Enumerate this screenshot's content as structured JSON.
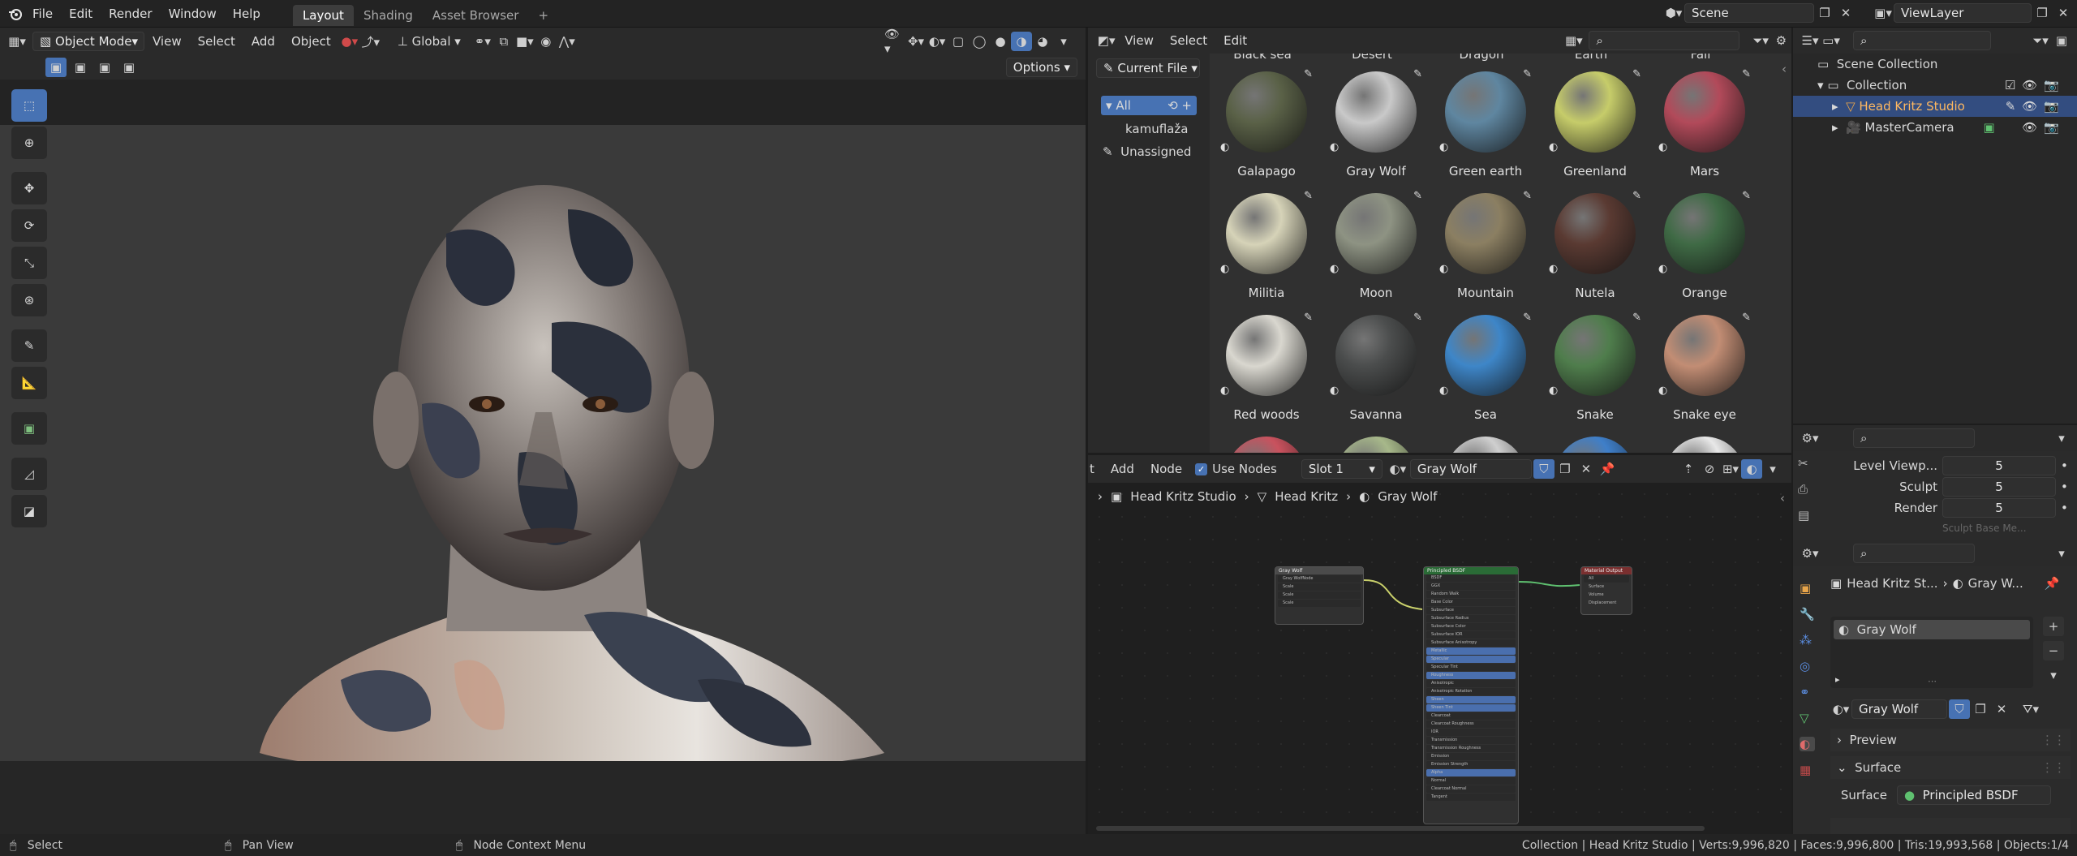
{
  "topbar": {
    "menus": [
      "File",
      "Edit",
      "Render",
      "Window",
      "Help"
    ],
    "workspaces": [
      {
        "label": "Layout",
        "active": true
      },
      {
        "label": "Shading",
        "active": false
      },
      {
        "label": "Asset Browser",
        "active": false
      }
    ],
    "add_tab": "+",
    "scene": "Scene",
    "view_layer": "ViewLayer"
  },
  "viewport": {
    "mode": "Object Mode",
    "menus": [
      "View",
      "Select",
      "Add",
      "Object"
    ],
    "orientation": "Global",
    "options_label": "Options"
  },
  "asset_browser": {
    "menus": [
      "View",
      "Select",
      "Edit"
    ],
    "library": "Current File",
    "catalogs": [
      "All",
      "kamuflaža",
      "Unassigned"
    ],
    "top_row_labels": [
      "Black sea",
      "Desert",
      "Dragon",
      "Earth",
      "Fall"
    ],
    "materials": [
      {
        "name": "Galapago",
        "color": "#5a6147"
      },
      {
        "name": "Gray Wolf",
        "color": "#c9c9c9"
      },
      {
        "name": "Green earth",
        "color": "#5f86a0"
      },
      {
        "name": "Greenland",
        "color": "#c6cc6a"
      },
      {
        "name": "Mars",
        "color": "#b24a5a"
      },
      {
        "name": "Militia",
        "color": "#d6d3b8"
      },
      {
        "name": "Moon",
        "color": "#8e9383"
      },
      {
        "name": "Mountain",
        "color": "#8b7f62"
      },
      {
        "name": "Nutela",
        "color": "#5a3a32"
      },
      {
        "name": "Orange",
        "color": "#3f6a45"
      },
      {
        "name": "Red woods",
        "color": "#d9d7cf"
      },
      {
        "name": "Savanna",
        "color": "#4b4d4d"
      },
      {
        "name": "Sea",
        "color": "#3e86c8"
      },
      {
        "name": "Snake",
        "color": "#4f7d4c"
      },
      {
        "name": "Snake eye",
        "color": "#c28d74"
      }
    ]
  },
  "node_editor": {
    "menus": [
      "Add",
      "Node"
    ],
    "use_nodes_label": "Use Nodes",
    "slot": "Slot 1",
    "material": "Gray Wolf",
    "breadcrumbs": [
      "Head Kritz Studio",
      "Head Kritz",
      "Gray Wolf"
    ],
    "nodes": {
      "texture": {
        "title": "Gray Wolf",
        "sub": "Gray WolfNode",
        "rows": [
          "Scale",
          "Scale",
          "Scale"
        ]
      },
      "bsdf": {
        "title": "Principled BSDF",
        "rows": [
          "BSDF",
          "GGX",
          "Random Walk",
          "Base Color",
          "Subsurface",
          "Subsurface Radius",
          "Subsurface Color",
          "Subsurface IOR",
          "Subsurface Anisotropy",
          "Metallic",
          "Specular",
          "Specular Tint",
          "Roughness",
          "Anisotropic",
          "Anisotropic Rotation",
          "Sheen",
          "Sheen Tint",
          "Clearcoat",
          "Clearcoat Roughness",
          "IOR",
          "Transmission",
          "Transmission Roughness",
          "Emission",
          "Emission Strength",
          "Alpha",
          "Normal",
          "Clearcoat Normal",
          "Tangent"
        ]
      },
      "output": {
        "title": "Material Output",
        "rows": [
          "All",
          "Surface",
          "Volume",
          "Displacement"
        ]
      }
    }
  },
  "outliner": {
    "rows": [
      {
        "label": "Scene Collection",
        "indent": 0
      },
      {
        "label": "Collection",
        "indent": 1
      },
      {
        "label": "Head Kritz Studio",
        "indent": 2,
        "selected": true
      },
      {
        "label": "MasterCamera",
        "indent": 2
      }
    ]
  },
  "properties_upper": {
    "rows": [
      {
        "label": "Level Viewp...",
        "value": "5"
      },
      {
        "label": "Sculpt",
        "value": "5"
      },
      {
        "label": "Render",
        "value": "5"
      }
    ],
    "cut_label": "Sculpt Base Me..."
  },
  "properties_material": {
    "breadcrumb": [
      "Head Kritz St...",
      "Gray W..."
    ],
    "slot_item": "Gray Wolf",
    "material_name": "Gray Wolf",
    "sections": [
      "Preview",
      "Surface"
    ],
    "surface_label": "Surface",
    "surface_value": "Principled BSDF"
  },
  "statusbar": {
    "select": "Select",
    "pan": "Pan View",
    "context": "Node Context Menu",
    "stats": "Collection | Head Kritz Studio | Verts:9,996,820 | Faces:9,996,800 | Tris:19,993,568 | Objects:1/4"
  }
}
